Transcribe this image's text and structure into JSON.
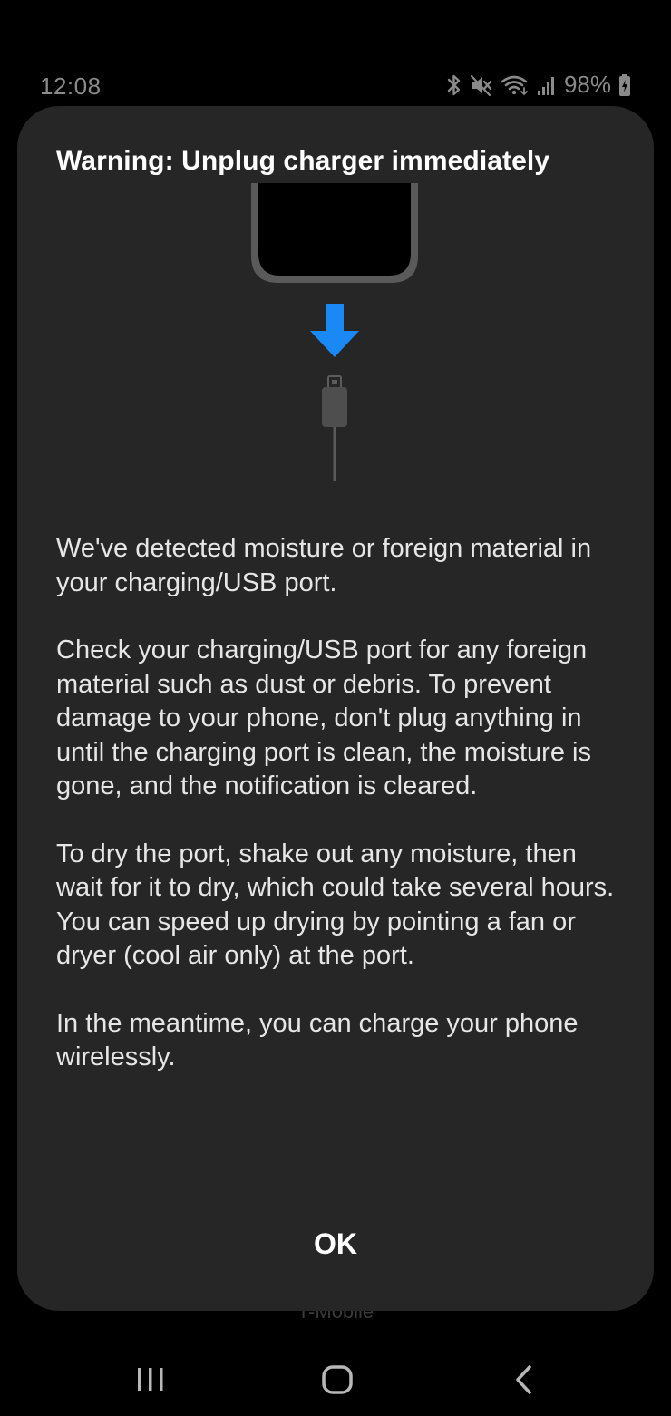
{
  "status_bar": {
    "time": "12:08",
    "battery": "98%",
    "icons": [
      "bluetooth-icon",
      "mute-icon",
      "wifi-icon",
      "signal-icon",
      "battery-charging-icon"
    ]
  },
  "background": {
    "carrier": "T-Mobile"
  },
  "dialog": {
    "title": "Warning: Unplug charger immediately",
    "illustration": {
      "phone": "phone-icon",
      "arrow": "arrow-down-icon",
      "cable": "usb-cable-icon",
      "arrow_color": "#1a88f5"
    },
    "paragraphs": [
      "We've detected moisture or foreign material in your charging/USB port.",
      "Check your charging/USB port for any foreign material such as dust or debris. To prevent damage to your phone, don't plug anything in until the charging port is clean, the moisture is gone, and the notification is cleared.",
      "To dry the port, shake out any moisture, then wait for it to dry, which could take several hours. You can speed up drying by pointing a fan or dryer (cool air only) at the port.",
      "In the meantime, you can charge your phone wirelessly."
    ],
    "ok_label": "OK"
  },
  "nav_bar": {
    "icons": [
      "recents-icon",
      "home-icon",
      "back-icon"
    ]
  },
  "colors": {
    "dialog_bg": "#262626",
    "background": "#000000",
    "accent": "#1a88f5"
  }
}
